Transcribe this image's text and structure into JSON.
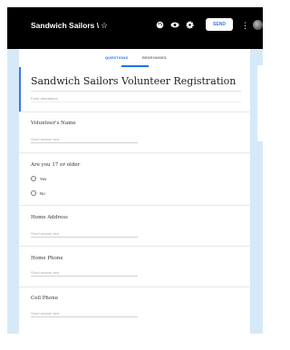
{
  "header": {
    "title": "Sandwich Sailors \\",
    "send_label": "SEND"
  },
  "icons": {
    "star": "star-icon",
    "palette": "palette-icon",
    "preview": "eye-icon",
    "settings": "gear-icon",
    "more": "more-vert-icon",
    "avatar": "avatar"
  },
  "tabs": {
    "questions": "QUESTIONS",
    "responses": "RESPONSES"
  },
  "form": {
    "title": "Sandwich Sailors Volunteer Registration",
    "description_placeholder": "Form description"
  },
  "questions": [
    {
      "label": "Volunteer's Name",
      "answer_placeholder": "Short answer text"
    },
    {
      "label": "Are you 17 or older",
      "options": [
        "Yes",
        "No"
      ]
    },
    {
      "label": "Home Address",
      "answer_placeholder": "Short answer text"
    },
    {
      "label": "Home Phone",
      "answer_placeholder": "Short answer text"
    },
    {
      "label": "Cell Phone",
      "answer_placeholder": "Short answer text"
    }
  ],
  "colors": {
    "accent": "#1a73e8",
    "canvas_bg": "#d6e9f8",
    "header_bg": "#000000"
  }
}
